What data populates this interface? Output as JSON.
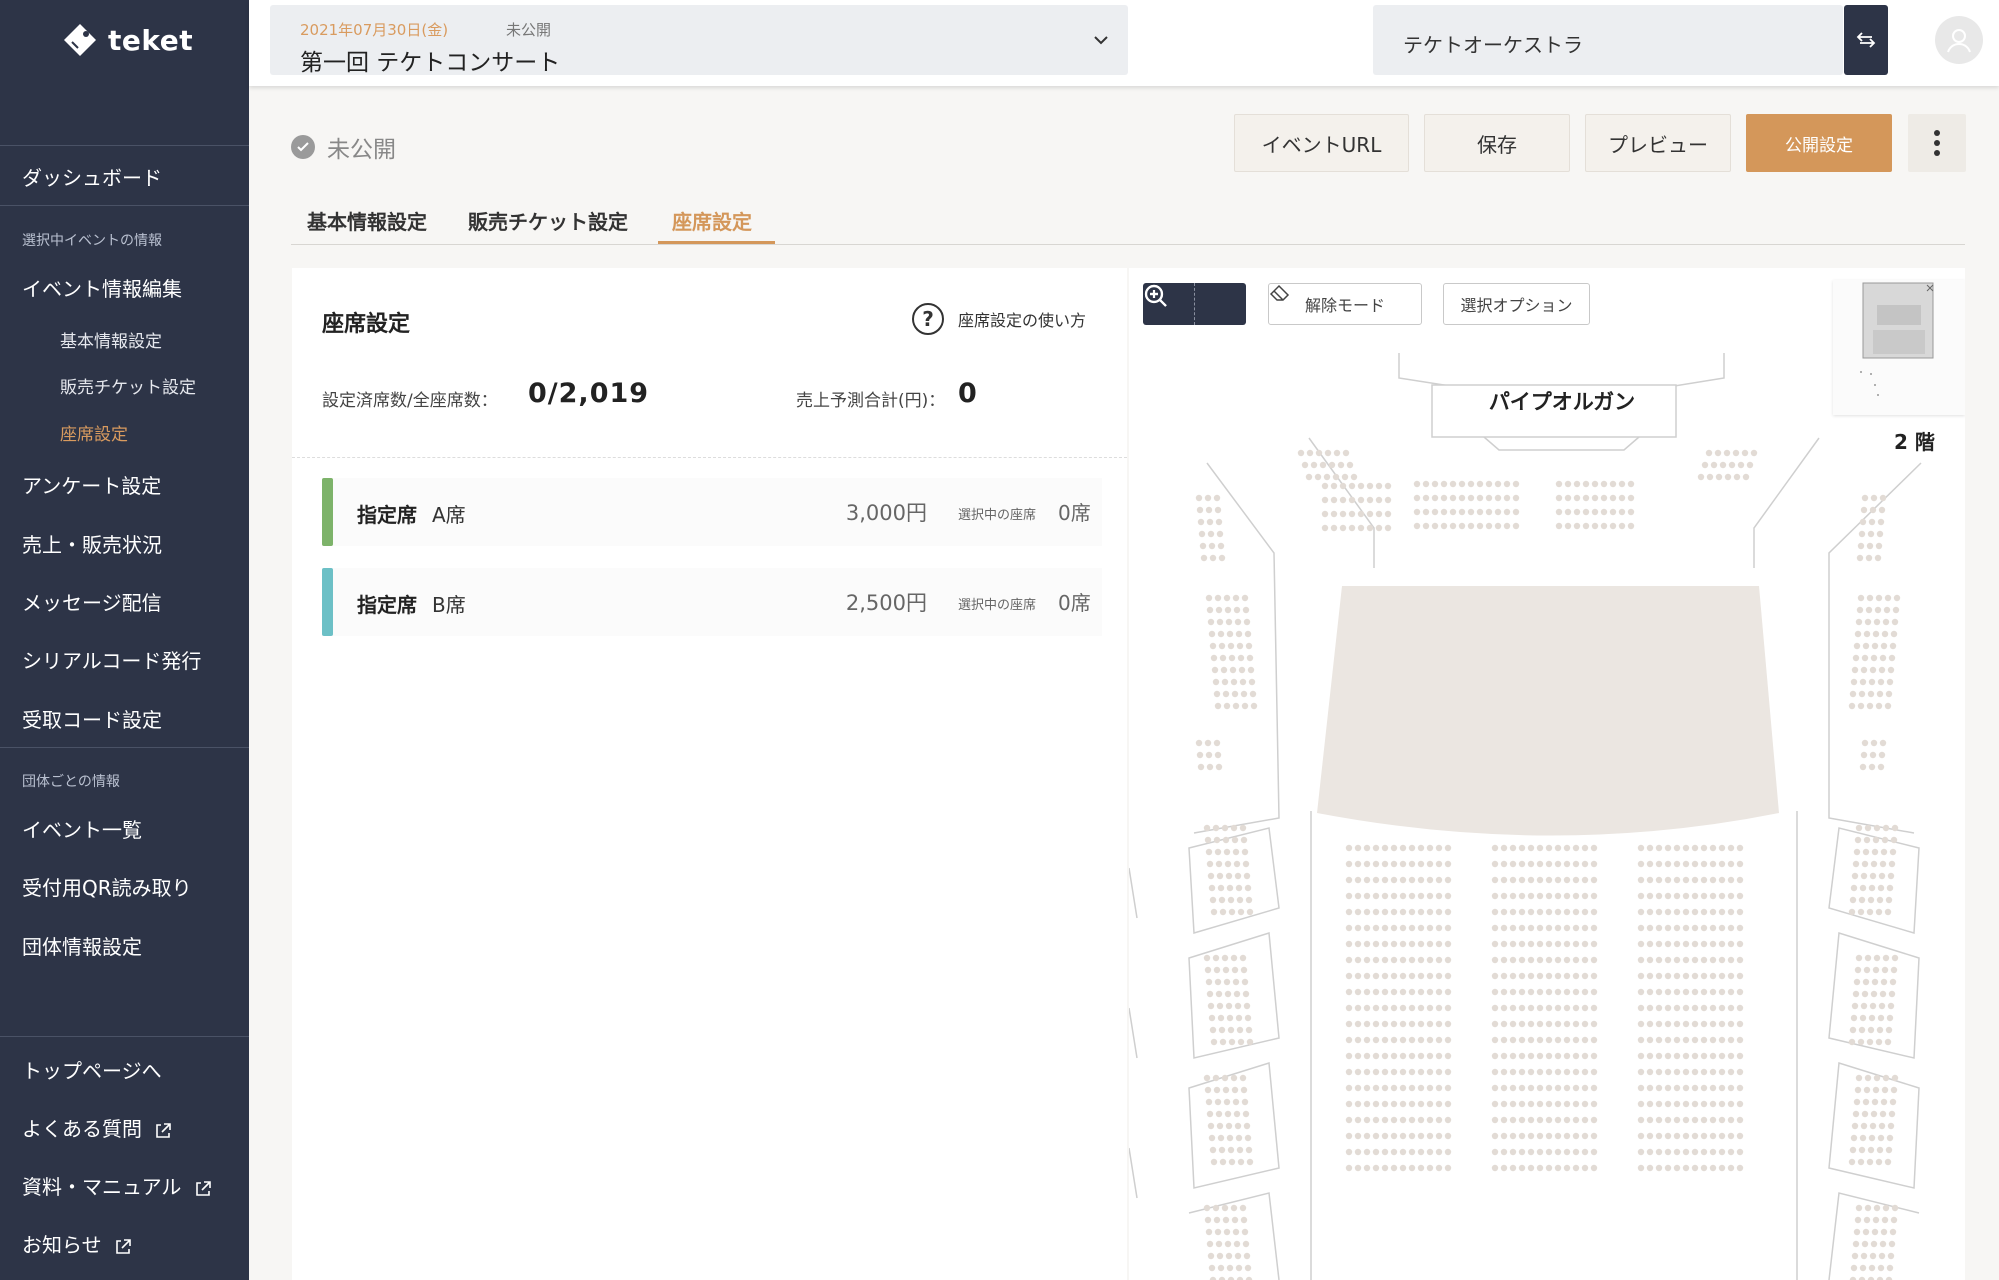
{
  "app": {
    "logo_text": "teket"
  },
  "sidebar": {
    "dashboard": "ダッシュボード",
    "section_event": "選択中イベントの情報",
    "event_edit": "イベント情報編集",
    "sub_basic": "基本情報設定",
    "sub_ticket": "販売チケット設定",
    "sub_seat": "座席設定",
    "survey": "アンケート設定",
    "sales": "売上・販売状況",
    "message": "メッセージ配信",
    "serial": "シリアルコード発行",
    "receive": "受取コード設定",
    "section_group": "団体ごとの情報",
    "event_list": "イベント一覧",
    "qr": "受付用QR読み取り",
    "group_settings": "団体情報設定",
    "top": "トップページへ",
    "faq": "よくある質問",
    "manual": "資料・マニュアル",
    "news": "お知らせ"
  },
  "topbar": {
    "event_date": "2021年07月30日(金)",
    "event_status": "未公開",
    "event_name": "第一回 テケトコンサート",
    "org_name": "テケトオーケストラ"
  },
  "status": {
    "label": "未公開"
  },
  "actions": {
    "event_url": "イベントURL",
    "save": "保存",
    "preview": "プレビュー",
    "publish": "公開設定"
  },
  "tabs": {
    "basic": "基本情報設定",
    "ticket": "販売チケット設定",
    "seat": "座席設定"
  },
  "panel": {
    "title": "座席設定",
    "help": "座席設定の使い方",
    "seats_label": "設定済席数/全座席数：",
    "seats_value": "0/2,019",
    "revenue_label": "売上予測合計(円)：",
    "revenue_value": "0",
    "seat_types": [
      {
        "kind": "指定席",
        "name": "A席",
        "price": "3,000円",
        "selected_label": "選択中の座席",
        "selected_count": "0席",
        "color": "#7db36a"
      },
      {
        "kind": "指定席",
        "name": "B席",
        "price": "2,500円",
        "selected_label": "選択中の座席",
        "selected_count": "0席",
        "color": "#6cc0c6"
      }
    ]
  },
  "map": {
    "release_mode": "解除モード",
    "select_option": "選択オプション",
    "organ": "パイプオルガン",
    "floor": "2 階"
  },
  "colors": {
    "sidebar_bg": "#2d3447",
    "accent": "#d4975a",
    "seat_dot": "#e2dbd5",
    "stage": "#ebe6e1"
  }
}
